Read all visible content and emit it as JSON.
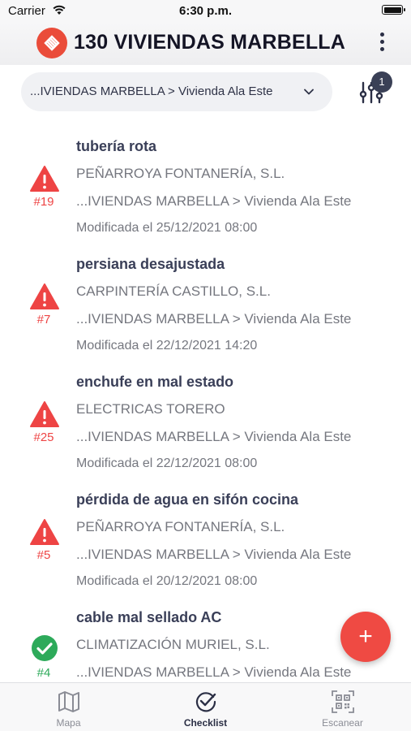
{
  "status_bar": {
    "carrier": "Carrier",
    "time": "6:30 p.m."
  },
  "header": {
    "title": "130 VIVIENDAS MARBELLA",
    "logo_icon": "logo-icon",
    "menu_icon": "more-vertical-icon"
  },
  "location": {
    "path": "...IVIENDAS MARBELLA > Vivienda Ala Este",
    "icon": "chevron-down-icon"
  },
  "filter": {
    "icon": "sliders-icon",
    "badge": "1"
  },
  "colors": {
    "accent": "#ea4c3a",
    "warning": "#ee4444",
    "ok": "#2daa5a",
    "text_dark": "#3a3f58",
    "text_gray": "#75777f"
  },
  "items": [
    {
      "title": "tubería rota",
      "company": "PEÑARROYA FONTANERÍA, S.L.",
      "path": "...IVIENDAS MARBELLA > Vivienda Ala Este",
      "modified": "Modificada el 25/12/2021 08:00",
      "number": "#19",
      "status": "warning-icon"
    },
    {
      "title": "persiana desajustada",
      "company": "CARPINTERÍA CASTILLO, S.L.",
      "path": "...IVIENDAS MARBELLA > Vivienda Ala Este",
      "modified": "Modificada el 22/12/2021 14:20",
      "number": "#7",
      "status": "warning-icon"
    },
    {
      "title": "enchufe en mal estado",
      "company": "ELECTRICAS TORERO",
      "path": "...IVIENDAS MARBELLA > Vivienda Ala Este",
      "modified": "Modificada el 22/12/2021 08:00",
      "number": "#25",
      "status": "warning-icon"
    },
    {
      "title": "pérdida de agua en sifón cocina",
      "company": "PEÑARROYA FONTANERÍA, S.L.",
      "path": "...IVIENDAS MARBELLA > Vivienda Ala Este",
      "modified": "Modificada el 20/12/2021 08:00",
      "number": "#5",
      "status": "warning-icon"
    },
    {
      "title": "cable mal sellado AC",
      "company": "CLIMATIZACIÓN MURIEL, S.L.",
      "path": "...IVIENDAS MARBELLA > Vivienda Ala Este",
      "modified": "",
      "number": "#4",
      "status": "check-circle-icon"
    }
  ],
  "fab": {
    "label": "+"
  },
  "tabs": [
    {
      "label": "Mapa",
      "icon": "map-icon"
    },
    {
      "label": "Checklist",
      "icon": "checklist-icon"
    },
    {
      "label": "Escanear",
      "icon": "qr-code-icon"
    }
  ]
}
